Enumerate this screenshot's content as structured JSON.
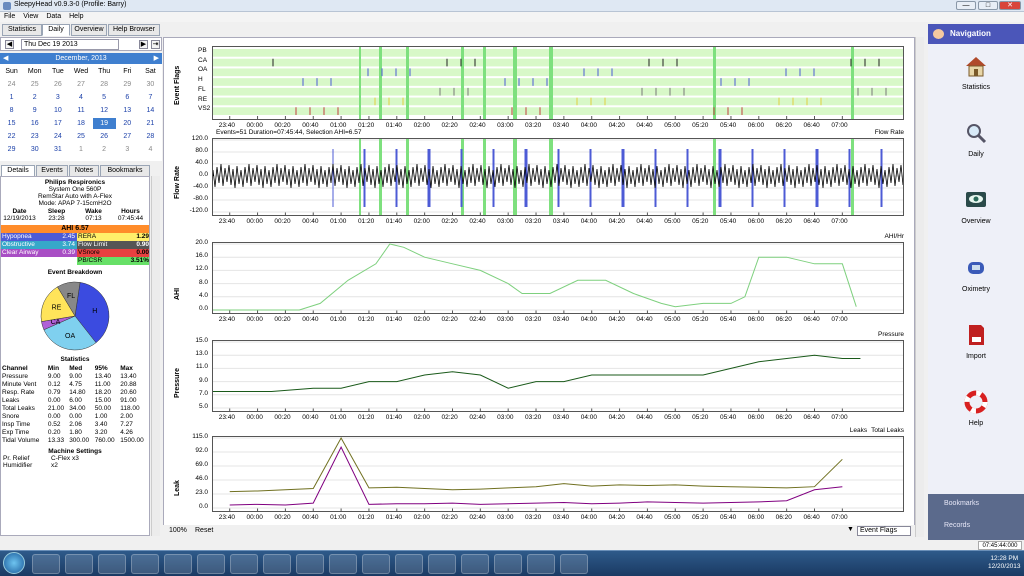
{
  "window": {
    "title": "SleepyHead v0.9.3-0 (Profile: Barry)"
  },
  "menu": [
    "File",
    "View",
    "Data",
    "Help"
  ],
  "tabs": [
    "Statistics",
    "Daily",
    "Overview",
    "Help Browser"
  ],
  "date": "Thu Dec 19 2013",
  "calendar": {
    "month": "December,  2013",
    "days": [
      "Sun",
      "Mon",
      "Tue",
      "Wed",
      "Thu",
      "Fri",
      "Sat"
    ],
    "cells": [
      "24",
      "25",
      "26",
      "27",
      "28",
      "29",
      "30",
      "1",
      "2",
      "3",
      "4",
      "5",
      "6",
      "7",
      "8",
      "9",
      "10",
      "11",
      "12",
      "13",
      "14",
      "15",
      "16",
      "17",
      "18",
      "19",
      "20",
      "21",
      "22",
      "23",
      "24",
      "25",
      "26",
      "27",
      "28",
      "29",
      "30",
      "31",
      "1",
      "2",
      "3",
      "4"
    ]
  },
  "detail_tabs": [
    "Details",
    "Events",
    "Notes",
    "Bookmarks"
  ],
  "machine": {
    "brand": "Philips Respironics",
    "model": "System One 560P",
    "mode_line": "RemStar Auto with A-Flex",
    "ap": "Mode: APAP 7-15cmH2O"
  },
  "session": {
    "headers": [
      "Date",
      "Sleep",
      "Wake",
      "Hours"
    ],
    "values": [
      "12/19/2013",
      "23:28",
      "07:13",
      "07:45:44"
    ]
  },
  "ahi": "AHI 6.57",
  "events": [
    {
      "name": "Hypopnea",
      "value": "2.45",
      "name2": "RERA",
      "value2": "1.29",
      "c1": "#4d5bd6",
      "c2": "#ffef6a"
    },
    {
      "name": "Obstructive",
      "value": "3.74",
      "name2": "Flow Limit",
      "value2": "0.90",
      "c1": "#36a7c9",
      "c2": "#555555"
    },
    {
      "name": "Clear Airway",
      "value": "0.39",
      "name2": "VSnore",
      "value2": "0.00",
      "c1": "#a84ec4",
      "c2": "#e84040"
    },
    {
      "name": "",
      "value": "",
      "name2": "PB/CSR",
      "value2": "3.51%",
      "c1": "#ffffff",
      "c2": "#67e067"
    }
  ],
  "breakdown_title": "Event Breakdown",
  "pie": {
    "labels": [
      "H",
      "OA",
      "CA",
      "RE",
      "FL"
    ],
    "colors": [
      "#3b4be0",
      "#7fd0ef",
      "#b060d8",
      "#ffe45a",
      "#888888"
    ],
    "values": [
      37,
      29,
      4,
      19,
      11
    ]
  },
  "stats_title": "Statistics",
  "stats": {
    "headers": [
      "Channel",
      "Min",
      "Med",
      "95%",
      "Max"
    ],
    "rows": [
      [
        "Pressure",
        "9.00",
        "9.00",
        "13.40",
        "13.40"
      ],
      [
        "Minute Vent",
        "0.12",
        "4.75",
        "11.00",
        "20.88"
      ],
      [
        "Resp. Rate",
        "0.79",
        "14.80",
        "18.20",
        "20.60"
      ],
      [
        "Leaks",
        "0.00",
        "6.00",
        "15.00",
        "91.00"
      ],
      [
        "Total Leaks",
        "21.00",
        "34.00",
        "50.00",
        "118.00"
      ],
      [
        "Snore",
        "0.00",
        "0.00",
        "1.00",
        "2.00"
      ],
      [
        "Insp Time",
        "0.52",
        "2.06",
        "3.40",
        "7.27"
      ],
      [
        "Exp Time",
        "0.20",
        "1.80",
        "3.20",
        "4.26"
      ],
      [
        "Tidal Volume",
        "13.33",
        "300.00",
        "760.00",
        "1500.00"
      ]
    ]
  },
  "machine_settings": {
    "title": "Machine Settings",
    "rows": [
      [
        "Pr. Relief",
        "C-Flex x3"
      ],
      [
        "Humidifier",
        "x2"
      ]
    ]
  },
  "time_labels": [
    "23:40",
    "00:00",
    "00:20",
    "00:40",
    "01:00",
    "01:20",
    "01:40",
    "02:00",
    "02:20",
    "02:40",
    "03:00",
    "03:20",
    "03:40",
    "04:00",
    "04:20",
    "04:40",
    "05:00",
    "05:20",
    "05:40",
    "06:00",
    "06:20",
    "06:40",
    "07:00"
  ],
  "charts": {
    "flags": {
      "ylabel": "Event Flags",
      "rows": [
        "PB",
        "CA",
        "OA",
        "H",
        "FL",
        "RE",
        "VS2"
      ]
    },
    "flow": {
      "ylabel": "Flow Rate",
      "legend": "Flow Rate",
      "summary": "Events=51 Duration=07:45:44, Selection AHI=6.57",
      "ticks": [
        "120.0",
        "80.0",
        "40.0",
        "0.0",
        "-40.0",
        "-80.0",
        "-120.0"
      ]
    },
    "ahi": {
      "ylabel": "AHI",
      "legend": "AHI/Hr",
      "ticks": [
        "20.0",
        "16.0",
        "12.0",
        "8.0",
        "4.0",
        "0.0"
      ]
    },
    "pressure": {
      "ylabel": "Pressure",
      "legend": "Pressure",
      "ticks": [
        "15.0",
        "13.0",
        "11.0",
        "9.0",
        "7.0",
        "5.0"
      ]
    },
    "leak": {
      "ylabel": "Leak",
      "legend": "Leaks",
      "legend2": "Total Leaks",
      "ticks": [
        "115.0",
        "92.0",
        "69.0",
        "46.0",
        "23.0",
        "0.0"
      ]
    }
  },
  "chart_data": [
    {
      "type": "line",
      "title": "",
      "ylabel": "AHI",
      "ylim": [
        0,
        20
      ],
      "x": [
        "23:28",
        "00:30",
        "00:45",
        "01:05",
        "01:25",
        "01:35",
        "01:45",
        "02:00",
        "02:20",
        "02:40",
        "03:00",
        "03:10",
        "03:30",
        "03:50",
        "04:10",
        "04:30",
        "04:50",
        "05:00",
        "05:20",
        "05:40",
        "05:50",
        "06:00",
        "06:20",
        "06:40",
        "07:00",
        "07:10"
      ],
      "values": [
        0,
        0,
        2,
        9,
        14,
        20,
        19,
        16,
        14,
        12,
        8,
        5,
        5,
        9,
        9,
        5,
        2,
        1,
        2,
        2,
        4,
        16,
        16,
        14,
        14,
        1
      ]
    },
    {
      "type": "line",
      "title": "",
      "ylabel": "Pressure",
      "ylim": [
        5,
        15
      ],
      "x": [
        "23:28",
        "00:10",
        "00:40",
        "01:00",
        "01:20",
        "01:40",
        "02:00",
        "02:20",
        "02:40",
        "03:00",
        "03:20",
        "03:40",
        "04:00",
        "04:30",
        "05:00",
        "05:20",
        "05:40",
        "06:00",
        "06:20",
        "06:40",
        "07:00",
        "07:13"
      ],
      "values": [
        7.5,
        7.5,
        8,
        8,
        9,
        9,
        10,
        10.5,
        10,
        8,
        9,
        9,
        10,
        10,
        10,
        10,
        11,
        12,
        12.5,
        13,
        12.5,
        12.5
      ]
    },
    {
      "type": "line",
      "title": "",
      "ylabel": "Leak",
      "ylim": [
        0,
        115
      ],
      "series": [
        {
          "name": "Leaks",
          "values": [
            5,
            6,
            5,
            8,
            100,
            6,
            7,
            7,
            8,
            6,
            7,
            8,
            9,
            7,
            8,
            10,
            9,
            8,
            9,
            10,
            12,
            30,
            35
          ]
        },
        {
          "name": "Total Leaks",
          "values": [
            27,
            28,
            30,
            32,
            115,
            33,
            34,
            32,
            30,
            31,
            33,
            35,
            40,
            36,
            38,
            37,
            38,
            36,
            35,
            34,
            33,
            35,
            80
          ]
        }
      ],
      "x": [
        "23:40",
        "00:00",
        "00:20",
        "00:40",
        "01:00",
        "01:20",
        "01:40",
        "02:00",
        "02:20",
        "02:40",
        "03:00",
        "03:20",
        "03:40",
        "04:00",
        "04:20",
        "04:40",
        "05:00",
        "05:20",
        "05:40",
        "06:00",
        "06:20",
        "06:40",
        "07:00"
      ]
    }
  ],
  "nav": {
    "title": "Navigation",
    "items": [
      "Statistics",
      "Daily",
      "Overview",
      "Oximetry",
      "Import",
      "Help"
    ],
    "footer": [
      "Bookmarks",
      "Records"
    ]
  },
  "bottom": {
    "zoom": "100%",
    "reset": "Reset",
    "select": "Event Flags"
  },
  "status_time": "07:45:44:000",
  "clock": {
    "time": "12:28 PM",
    "date": "12/20/2013"
  }
}
